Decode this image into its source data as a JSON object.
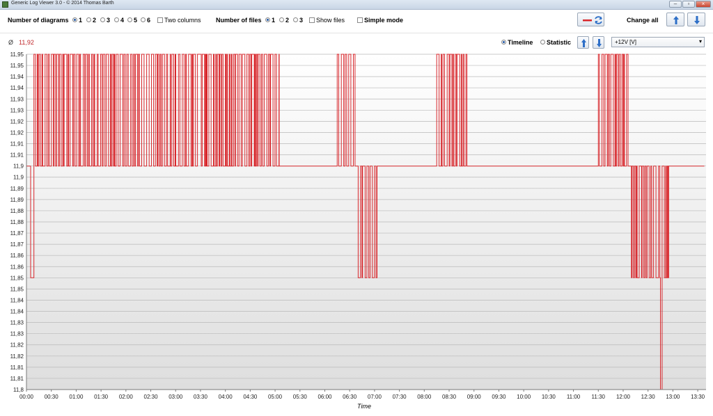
{
  "window": {
    "title": "Generic Log Viewer 3.0 - © 2014 Thomas Barth"
  },
  "toolbar": {
    "diagrams_label": "Number of diagrams",
    "diagram_options": [
      "1",
      "2",
      "3",
      "4",
      "5",
      "6"
    ],
    "diagram_selected": "1",
    "two_columns_label": "Two columns",
    "files_label": "Number of files",
    "file_options": [
      "1",
      "2",
      "3"
    ],
    "file_selected": "1",
    "show_files_label": "Show files",
    "simple_mode_label": "Simple mode",
    "change_all_label": "Change all"
  },
  "diagram": {
    "avg_symbol": "Ø",
    "avg_value": "11,92",
    "view_timeline": "Timeline",
    "view_statistic": "Statistic",
    "view_selected": "Timeline",
    "channel": "+12V [V]"
  },
  "colors": {
    "series": "#d8262b",
    "accent_blue": "#2e6fc7"
  },
  "chart_data": {
    "type": "line",
    "xlabel": "Time",
    "ylabel": "",
    "x_ticks": [
      "00:00",
      "00:30",
      "01:00",
      "01:30",
      "02:00",
      "02:30",
      "03:00",
      "03:30",
      "04:00",
      "04:30",
      "05:00",
      "05:30",
      "06:00",
      "06:30",
      "07:00",
      "07:30",
      "08:00",
      "08:30",
      "09:00",
      "09:30",
      "10:00",
      "10:30",
      "11:00",
      "11:30",
      "12:00",
      "12:30",
      "13:00",
      "13:30"
    ],
    "y_ticks": [
      "11,8",
      "11,81",
      "11,81",
      "11,82",
      "11,82",
      "11,83",
      "11,83",
      "11,84",
      "11,84",
      "11,85",
      "11,85",
      "11,86",
      "11,86",
      "11,87",
      "11,87",
      "11,88",
      "11,88",
      "11,89",
      "11,89",
      "11,9",
      "11,9",
      "11,91",
      "11,91",
      "11,92",
      "11,92",
      "11,93",
      "11,93",
      "11,94",
      "11,94",
      "11,95",
      "11,95"
    ],
    "ylim": [
      11.8,
      11.95
    ],
    "xlim_minutes": [
      0,
      820
    ],
    "grid": true,
    "series": [
      {
        "segments": [
          {
            "from": "00:00",
            "to": "00:05",
            "value": 11.9
          },
          {
            "from": "00:05",
            "to": "00:09",
            "value": 11.85
          },
          {
            "from": "00:09",
            "to": "00:50",
            "value": 11.95,
            "fluctuating_to": 11.9
          },
          {
            "from": "00:50",
            "to": "03:28",
            "value": 11.95,
            "fluctuating_to": 11.9
          },
          {
            "from": "03:28",
            "to": "05:05",
            "value": 11.95,
            "fluctuating_to": 11.9
          },
          {
            "from": "05:05",
            "to": "06:15",
            "value": 11.9
          },
          {
            "from": "06:15",
            "to": "06:38",
            "value": 11.95,
            "fluctuating_to": 11.9
          },
          {
            "from": "06:38",
            "to": "07:03",
            "value": 11.9,
            "fluctuating_to": 11.85
          },
          {
            "from": "07:03",
            "to": "08:15",
            "value": 11.9
          },
          {
            "from": "08:15",
            "to": "08:53",
            "value": 11.95,
            "fluctuating_to": 11.9
          },
          {
            "from": "08:53",
            "to": "11:30",
            "value": 11.9
          },
          {
            "from": "11:30",
            "to": "12:07",
            "value": 11.95,
            "fluctuating_to": 11.9
          },
          {
            "from": "12:07",
            "to": "12:45",
            "value": 11.9,
            "fluctuating_to": 11.85
          },
          {
            "from": "12:45",
            "to": "12:47",
            "value": 11.8
          },
          {
            "from": "12:47",
            "to": "12:55",
            "value": 11.9,
            "fluctuating_to": 11.85
          },
          {
            "from": "12:55",
            "to": "13:38",
            "value": 11.9
          }
        ]
      }
    ]
  }
}
